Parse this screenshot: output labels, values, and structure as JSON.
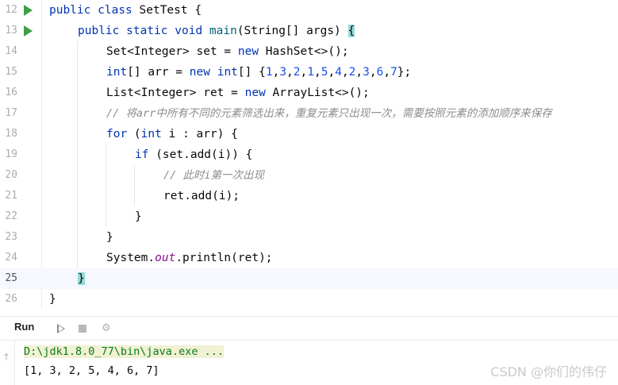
{
  "editor": {
    "line_numbers": [
      "12",
      "13",
      "14",
      "15",
      "16",
      "17",
      "18",
      "19",
      "20",
      "21",
      "22",
      "23",
      "24",
      "25",
      "26"
    ],
    "lines": {
      "l12": {
        "kw1": "public",
        "kw2": "class",
        "rest": " SetTest {"
      },
      "l13": {
        "kw1": "public",
        "kw2": "static",
        "kw3": "void",
        "fn": "main",
        "rest": "(String[] args) ",
        "brace": "{"
      },
      "l14": {
        "a": "Set<Integer> set = ",
        "kw": "new",
        "b": " HashSet<>();"
      },
      "l15": {
        "kw1": "int",
        "a": "[] arr = ",
        "kw2": "new",
        "kw3": "int",
        "b": "[] {",
        "nums": [
          "1",
          "3",
          "2",
          "1",
          "5",
          "4",
          "2",
          "3",
          "6",
          "7"
        ],
        "c": "};"
      },
      "l16": {
        "a": "List<Integer> ret = ",
        "kw": "new",
        "b": " ArrayList<>();"
      },
      "l17": {
        "comment": "// 将arr中所有不同的元素筛选出来，重复元素只出现一次，需要按照元素的添加顺序来保存"
      },
      "l18": {
        "kw1": "for",
        "a": " (",
        "kw2": "int",
        "b": " i : arr) {"
      },
      "l19": {
        "kw": "if",
        "a": " (set.add(i)) {"
      },
      "l20": {
        "comment": "// 此时i第一次出现"
      },
      "l21": {
        "a": "ret.add(i);"
      },
      "l22": {
        "a": "}"
      },
      "l23": {
        "a": "}"
      },
      "l24": {
        "a": "System.",
        "field": "out",
        "b": ".println(ret);"
      },
      "l25": {
        "brace": "}"
      },
      "l26": {
        "a": "}"
      }
    }
  },
  "run_panel": {
    "title": "Run",
    "icons": [
      "rerun-icon",
      "stop-icon",
      "debug-icon"
    ],
    "command": "D:\\jdk1.8.0_77\\bin\\java.exe ...",
    "output": "[1, 3, 2, 5, 4, 6, 7]"
  },
  "watermark": "CSDN @你们的伟仔",
  "colors": {
    "keyword": "#0033b3",
    "number": "#1750eb",
    "comment": "#8c8c8c",
    "run": "#3f9f46",
    "cmd": "#067d17"
  }
}
